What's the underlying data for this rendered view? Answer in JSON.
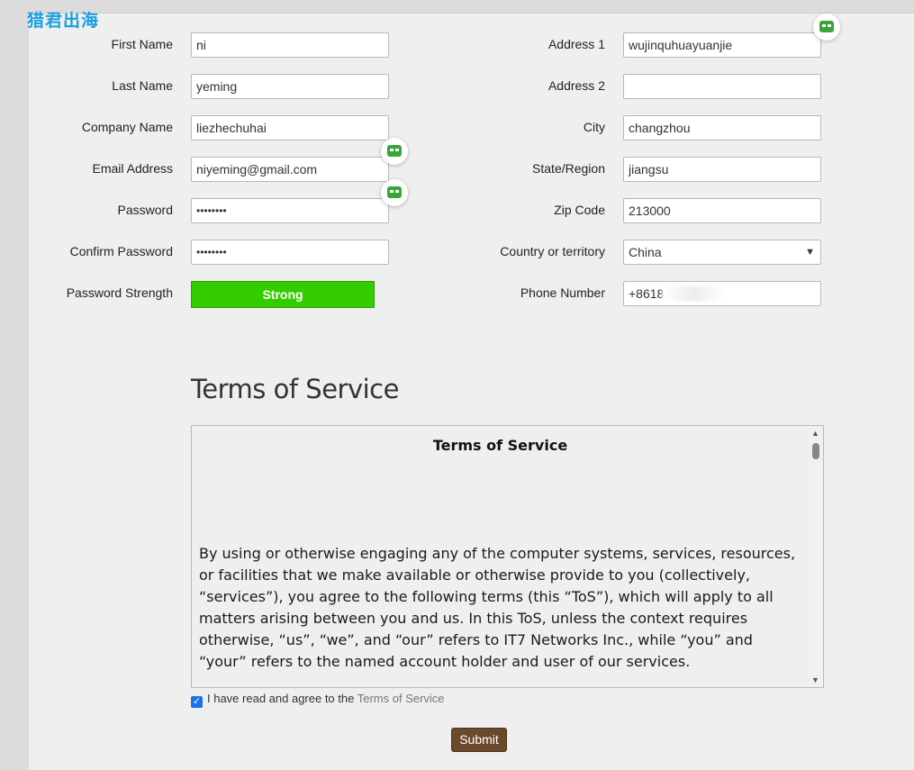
{
  "watermark": "猎君出海",
  "left_fields": [
    {
      "label": "First Name",
      "value": "ni"
    },
    {
      "label": "Last Name",
      "value": "yeming"
    },
    {
      "label": "Company Name",
      "value": "liezhechuhai"
    },
    {
      "label": "Email Address",
      "value": "niyeming@gmail.com"
    },
    {
      "label": "Password",
      "value": "••••••••"
    },
    {
      "label": "Confirm Password",
      "value": "••••••••"
    }
  ],
  "password_strength": {
    "label": "Password Strength",
    "value": "Strong",
    "color": "#33cc00"
  },
  "right_fields": [
    {
      "label": "Address 1",
      "value": "wujinquhuayuanjie"
    },
    {
      "label": "Address 2",
      "value": ""
    },
    {
      "label": "City",
      "value": "changzhou"
    },
    {
      "label": "State/Region",
      "value": "jiangsu"
    },
    {
      "label": "Zip Code",
      "value": "213000"
    },
    {
      "label": "Country or territory",
      "value": "China"
    },
    {
      "label": "Phone Number",
      "value": "+8618"
    }
  ],
  "tos": {
    "heading": "Terms of Service",
    "box_title": "Terms of Service",
    "body": "By using or otherwise engaging any of the computer systems, services, resources, or facilities that we make available or otherwise provide to you (collectively, “services”), you agree to the following terms (this “ToS”), which will apply to all matters arising between you and us. In this ToS, unless the context requires otherwise, “us”, “we”, and “our” refers to IT7 Networks Inc., while “you” and “your” refers to the named account holder and user of our services."
  },
  "agree": {
    "checked": true,
    "text": "I have read and agree to the ",
    "link": "Terms of Service"
  },
  "submit_label": "Submit",
  "icons": {
    "password_manager": "password-manager-icon",
    "chevron": "chevron-down-icon",
    "check": "checkmark-icon"
  }
}
